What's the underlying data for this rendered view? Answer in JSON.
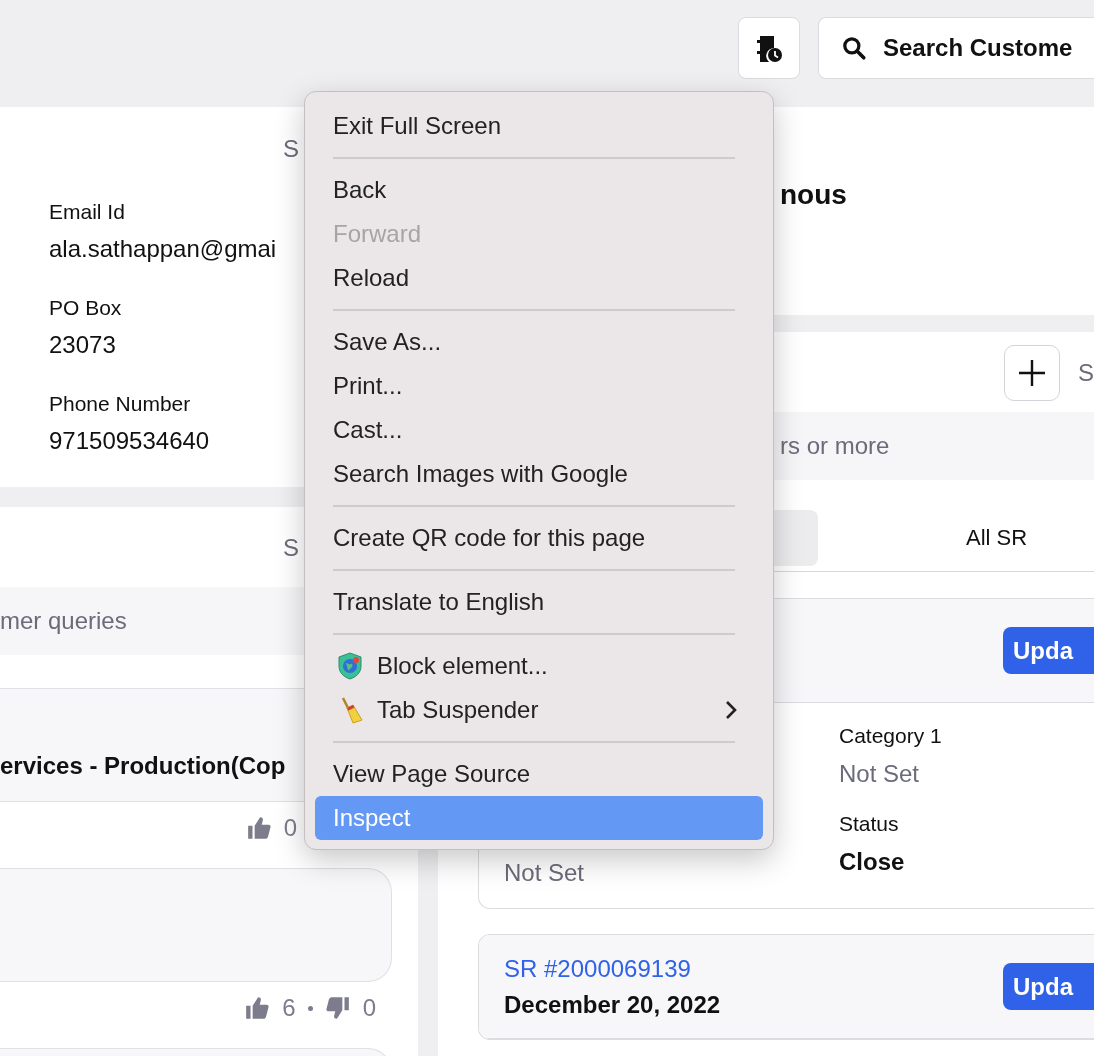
{
  "top_bar": {
    "search_button": {
      "label": "Search Custome"
    }
  },
  "customer_card": {
    "header_text": "S",
    "fields": [
      {
        "label": "Email Id",
        "value": "ala.sathappan@gmai"
      },
      {
        "label": "PO Box",
        "value": "23073"
      },
      {
        "label": "Phone Number",
        "value": "971509534640"
      }
    ]
  },
  "queries_panel": {
    "header_text": "S",
    "search": {
      "placeholder": "mer queries"
    },
    "articles": [
      {
        "title": "ervices - Production(Cop",
        "likes": "0"
      },
      {
        "likes": "6",
        "dislikes": "0"
      }
    ]
  },
  "profile_card": {
    "name": "nous"
  },
  "sr_panel": {
    "header_text": "S",
    "search": {
      "placeholder": "rs or more"
    },
    "tabs": [
      {
        "selected": true
      },
      {
        "label": "All SR",
        "selected": false
      }
    ],
    "requests": [
      {
        "button": "Upda",
        "left_fields": [
          {
            "value": "Not Set",
            "kind": "muted"
          }
        ],
        "right_fields": [
          {
            "label": "Category 1",
            "value": "Not Set",
            "kind": "muted"
          },
          {
            "label": "Status",
            "value": "Close",
            "kind": "strong"
          }
        ]
      },
      {
        "button": "Upda",
        "link": "SR #2000069139",
        "date": "December 20, 2022"
      }
    ]
  },
  "context_menu": {
    "items": [
      {
        "kind": "item",
        "label": "Exit Full Screen",
        "disabled": false,
        "selected": false
      },
      {
        "kind": "separator"
      },
      {
        "kind": "item",
        "label": "Back",
        "disabled": false,
        "selected": false
      },
      {
        "kind": "item",
        "label": "Forward",
        "disabled": true,
        "selected": false
      },
      {
        "kind": "item",
        "label": "Reload",
        "disabled": false,
        "selected": false
      },
      {
        "kind": "separator"
      },
      {
        "kind": "item",
        "label": "Save As...",
        "disabled": false,
        "selected": false
      },
      {
        "kind": "item",
        "label": "Print...",
        "disabled": false,
        "selected": false
      },
      {
        "kind": "item",
        "label": "Cast...",
        "disabled": false,
        "selected": false
      },
      {
        "kind": "item",
        "label": "Search Images with Google",
        "disabled": false,
        "selected": false
      },
      {
        "kind": "separator"
      },
      {
        "kind": "item",
        "label": "Create QR code for this page",
        "disabled": false,
        "selected": false
      },
      {
        "kind": "separator"
      },
      {
        "kind": "item",
        "label": "Translate to English",
        "disabled": false,
        "selected": false
      },
      {
        "kind": "separator"
      },
      {
        "kind": "extension",
        "label": "Block element...",
        "disabled": false,
        "selected": false
      },
      {
        "kind": "extension",
        "label": "Tab Suspender",
        "submenu": true,
        "disabled": false,
        "selected": false
      },
      {
        "kind": "separator"
      },
      {
        "kind": "item",
        "label": "View Page Source",
        "disabled": false,
        "selected": false
      },
      {
        "kind": "item",
        "label": "Inspect",
        "disabled": false,
        "selected": true
      }
    ]
  }
}
